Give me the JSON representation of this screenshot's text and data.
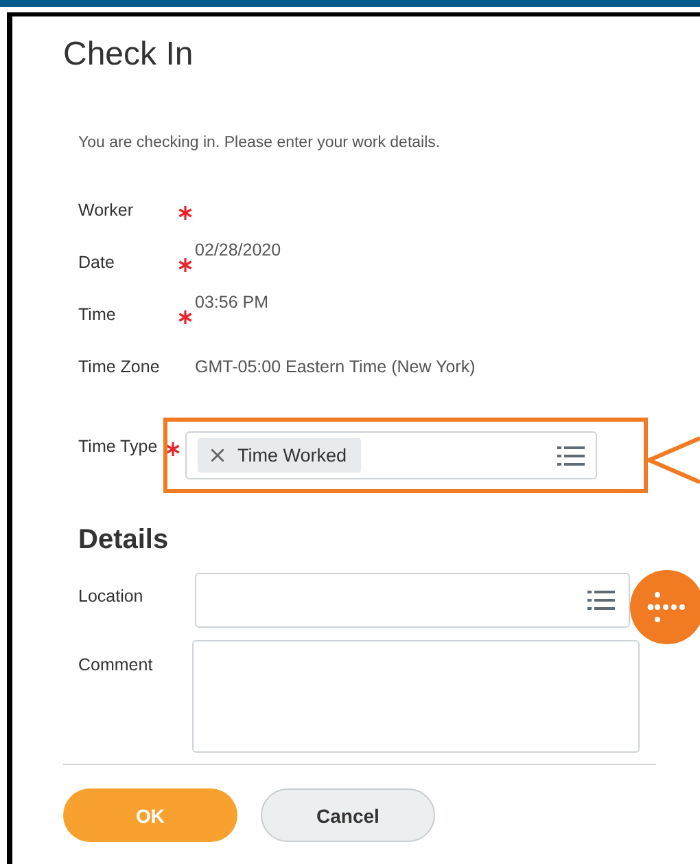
{
  "dialog": {
    "title": "Check In",
    "intro": "You are checking in.  Please enter your work details."
  },
  "fields": [
    {
      "label": "Worker",
      "required": true
    },
    {
      "label": "Date",
      "required": true,
      "value": "02/28/2020"
    },
    {
      "label": "Time",
      "required": true,
      "value": "03:56 PM"
    },
    {
      "label": "Time Zone",
      "required": false,
      "value": "GMT-05:00 Eastern Time (New York)"
    },
    {
      "label": "Time Type",
      "required": true,
      "kind": "multiselect",
      "tokens": [
        "Time Worked"
      ],
      "highlighted": true
    }
  ],
  "details": {
    "heading": "Details",
    "fields": [
      {
        "label": "Location",
        "kind": "prompt"
      },
      {
        "label": "Comment",
        "kind": "textarea"
      }
    ]
  },
  "buttons": [
    {
      "label": "OK",
      "kind": "primary"
    },
    {
      "label": "Cancel",
      "kind": "secondary"
    }
  ]
}
